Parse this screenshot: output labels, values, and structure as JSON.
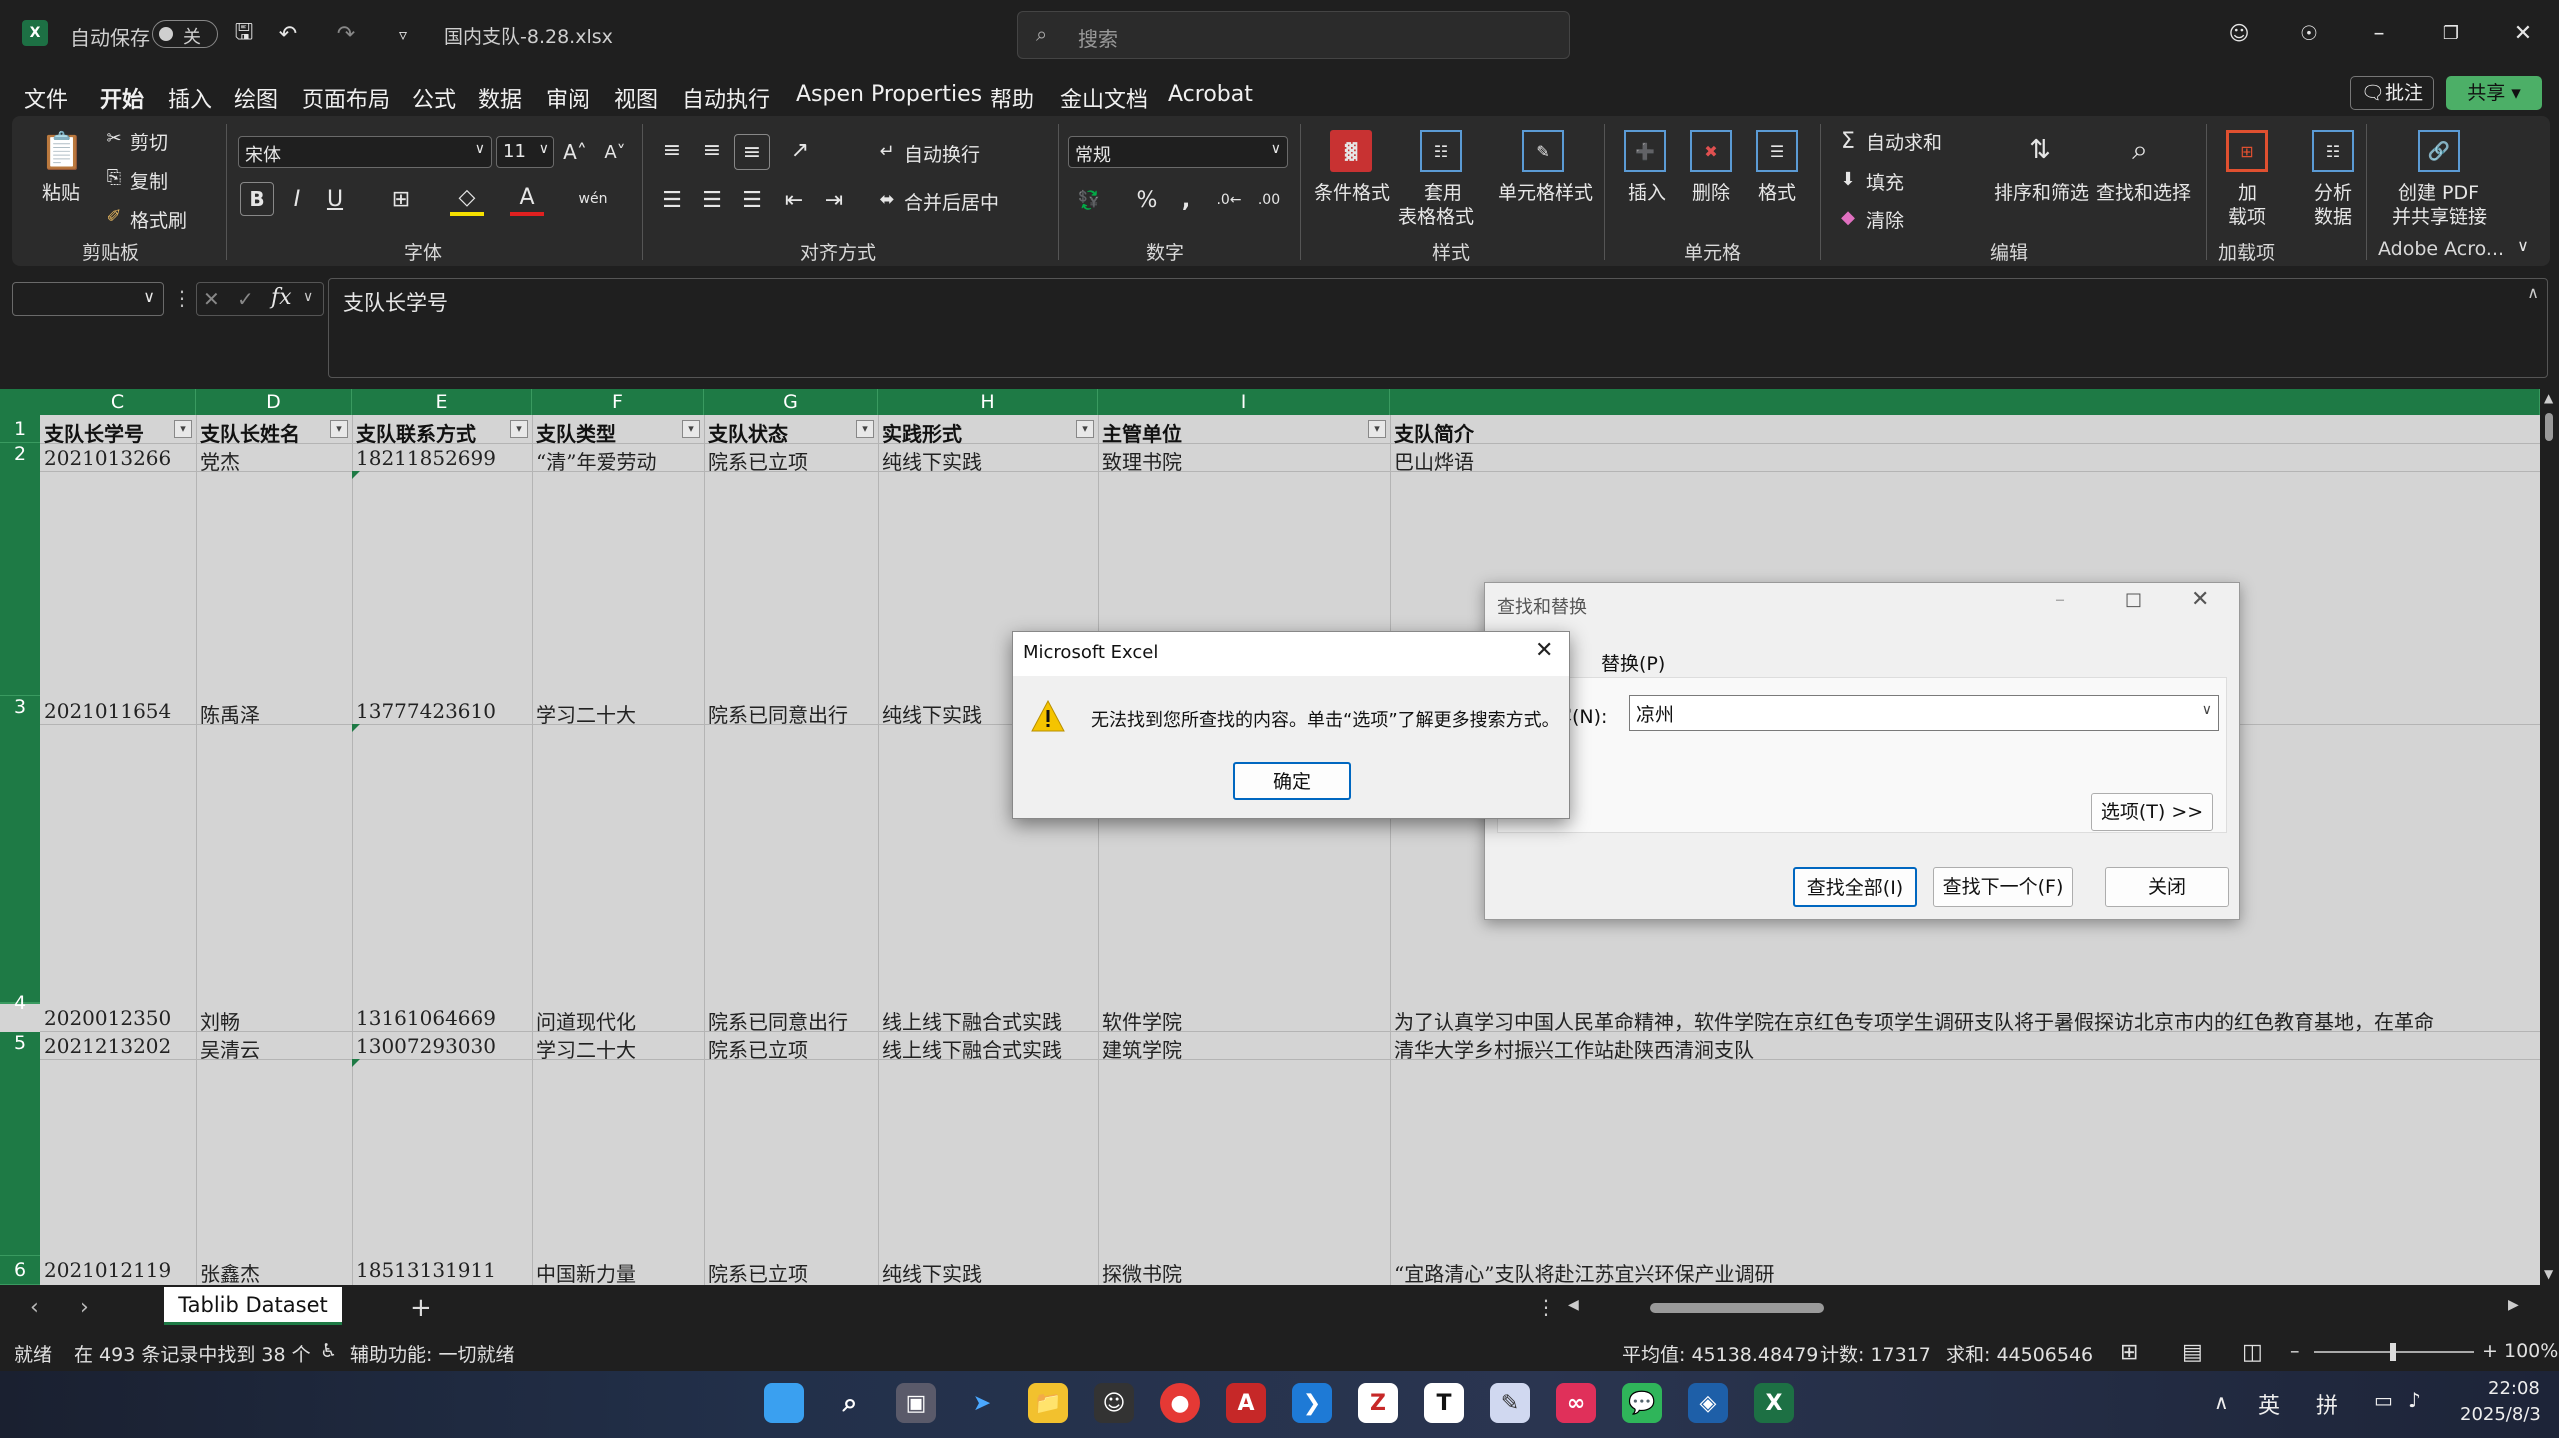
{
  "titlebar": {
    "autosave_label": "自动保存",
    "autosave_state": "关",
    "file_name": "国内支队-8.28.xlsx",
    "search_placeholder": "搜索"
  },
  "menu": [
    "文件",
    "开始",
    "插入",
    "绘图",
    "页面布局",
    "公式",
    "数据",
    "审阅",
    "视图",
    "自动执行",
    "Aspen Properties",
    "帮助",
    "金山文档",
    "Acrobat"
  ],
  "menu_right": {
    "comment": "批注",
    "share": "共享"
  },
  "ribbon": {
    "paste": "粘贴",
    "cut": "剪切",
    "copy": "复制",
    "format_painter": "格式刷",
    "clipboard": "剪贴板",
    "font_name": "宋体",
    "font_size": "11",
    "font": "字体",
    "wrap": "自动换行",
    "merge": "合并后居中",
    "alignment": "对齐方式",
    "number_format": "常规",
    "number": "数字",
    "cond_format": "条件格式",
    "table_format_1": "套用",
    "table_format_2": "表格格式",
    "cell_style": "单元格样式",
    "styles": "样式",
    "insert": "插入",
    "delete": "删除",
    "format": "格式",
    "cells": "单元格",
    "autosum": "自动求和",
    "fill": "填充",
    "clear": "清除",
    "sort_filter": "排序和筛选",
    "find_select": "查找和选择",
    "editing": "编辑",
    "addins_1": "加",
    "addins_2": "载项",
    "addins": "加载项",
    "analyze_1": "分析",
    "analyze_2": "数据",
    "pdf_1": "创建 PDF",
    "pdf_2": "并共享链接",
    "adobe": "Adobe Acro..."
  },
  "formula_bar": {
    "value": "支队长学号",
    "fx": "fx"
  },
  "columns": [
    {
      "letter": "C",
      "header": "支队长学号"
    },
    {
      "letter": "D",
      "header": "支队长姓名"
    },
    {
      "letter": "E",
      "header": "支队联系方式"
    },
    {
      "letter": "F",
      "header": "支队类型"
    },
    {
      "letter": "G",
      "header": "支队状态"
    },
    {
      "letter": "H",
      "header": "实践形式"
    },
    {
      "letter": "I",
      "header": "主管单位"
    },
    {
      "letter": "",
      "header": "支队简介"
    }
  ],
  "rows": [
    {
      "num": "1"
    },
    {
      "num": "2",
      "cells": [
        "2021013266",
        "党杰",
        "18211852699",
        "“清”年爱劳动",
        "院系已立项",
        "纯线下实践",
        "致理书院",
        "巴山烨语"
      ]
    },
    {
      "num": "3",
      "cells": [
        "2021011654",
        "陈禹泽",
        "13777423610",
        "学习二十大",
        "院系已同意出行",
        "纯线下实践",
        "",
        ""
      ]
    },
    {
      "num": "4",
      "cells": [
        "2020012350",
        "刘畅",
        "13161064669",
        "问道现代化",
        "院系已同意出行",
        "线上线下融合式实践",
        "软件学院",
        "为了认真学习中国人民革命精神，软件学院在京红色专项学生调研支队将于暑假探访北京市内的红色教育基地，在革命"
      ]
    },
    {
      "num": "5",
      "cells": [
        "2021213202",
        "吴清云",
        "13007293030",
        "学习二十大",
        "院系已立项",
        "线上线下融合式实践",
        "建筑学院",
        "清华大学乡村振兴工作站赴陕西清涧支队"
      ]
    },
    {
      "num": "6",
      "cells": [
        "2021012119",
        "张鑫杰",
        "18513131911",
        "中国新力量",
        "院系已立项",
        "纯线下实践",
        "探微书院",
        "“宜路清心”支队将赴江苏宜兴环保产业调研"
      ]
    }
  ],
  "find_dialog": {
    "title": "查找和替换",
    "tab_replace": "替换(P)",
    "find_label": "容(N):",
    "find_value": "凉州",
    "options_btn": "选项(T) >>",
    "find_all": "查找全部(I)",
    "find_next": "查找下一个(F)",
    "close": "关闭"
  },
  "message_dialog": {
    "title": "Microsoft Excel",
    "message": "无法找到您所查找的内容。单击“选项”了解更多搜索方式。",
    "ok": "确定"
  },
  "sheet_tab": "Tablib Dataset",
  "status": {
    "ready": "就绪",
    "found": "在 493 条记录中找到 38 个",
    "accessibility": "辅助功能: 一切就绪",
    "average": "平均值: 45138.48479",
    "count": "计数: 17317",
    "sum": "求和: 44506546",
    "zoom": "100%"
  },
  "taskbar": {
    "ime_1": "英",
    "ime_2": "拼",
    "time": "22:08",
    "date": "2025/8/3"
  }
}
